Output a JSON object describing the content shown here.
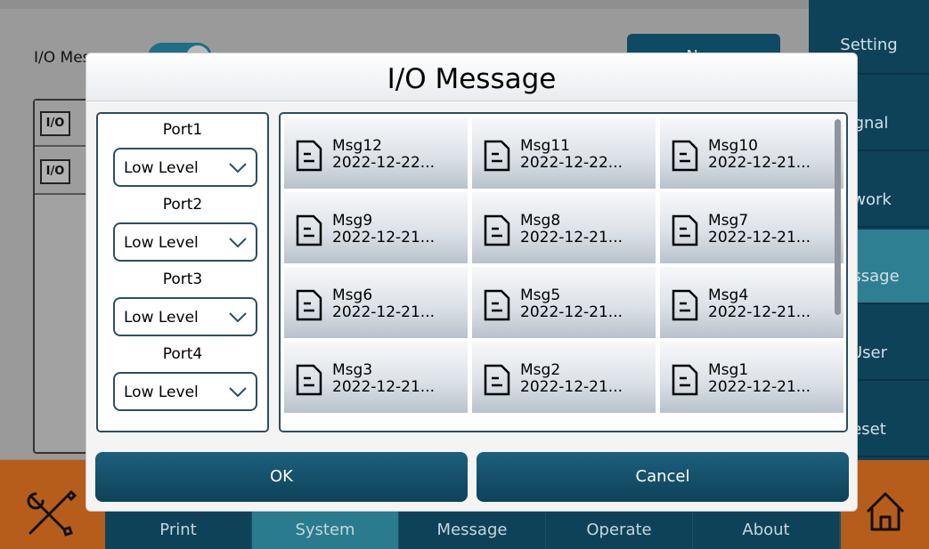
{
  "background": {
    "toggle_label": "I/O Message",
    "new_button": "New",
    "io_icons": [
      "I/O",
      "I/O"
    ],
    "side_menu": [
      {
        "label": "Setting",
        "active": false
      },
      {
        "label": "ignal",
        "active": false
      },
      {
        "label": "twork",
        "active": false
      },
      {
        "label": "lessage",
        "active": true
      },
      {
        "label": "User",
        "active": false
      },
      {
        "label": "eset",
        "active": false
      }
    ],
    "bottom_tabs": [
      {
        "label": "Print",
        "active": false
      },
      {
        "label": "System",
        "active": true
      },
      {
        "label": "Message",
        "active": false
      },
      {
        "label": "Operate",
        "active": false
      },
      {
        "label": "About",
        "active": false
      }
    ],
    "colors": {
      "accent": "#0e4259",
      "active_tab": "#2a7b8d",
      "orange": "#b65d1b"
    }
  },
  "dialog": {
    "title": "I/O Message",
    "ports": [
      {
        "label": "Port1",
        "value": "Low Level"
      },
      {
        "label": "Port2",
        "value": "Low Level"
      },
      {
        "label": "Port3",
        "value": "Low Level"
      },
      {
        "label": "Port4",
        "value": "Low Level"
      }
    ],
    "messages": [
      {
        "name": "Msg12",
        "date": "2022-12-22..."
      },
      {
        "name": "Msg11",
        "date": "2022-12-22..."
      },
      {
        "name": "Msg10",
        "date": "2022-12-21..."
      },
      {
        "name": "Msg9",
        "date": "2022-12-21..."
      },
      {
        "name": "Msg8",
        "date": "2022-12-21..."
      },
      {
        "name": "Msg7",
        "date": "2022-12-21..."
      },
      {
        "name": "Msg6",
        "date": "2022-12-21..."
      },
      {
        "name": "Msg5",
        "date": "2022-12-21..."
      },
      {
        "name": "Msg4",
        "date": "2022-12-21..."
      },
      {
        "name": "Msg3",
        "date": "2022-12-21..."
      },
      {
        "name": "Msg2",
        "date": "2022-12-21..."
      },
      {
        "name": "Msg1",
        "date": "2022-12-21..."
      }
    ],
    "ok_label": "OK",
    "cancel_label": "Cancel",
    "icons": {
      "file": "file-text-icon",
      "dropdown": "chevron-down-icon"
    }
  }
}
